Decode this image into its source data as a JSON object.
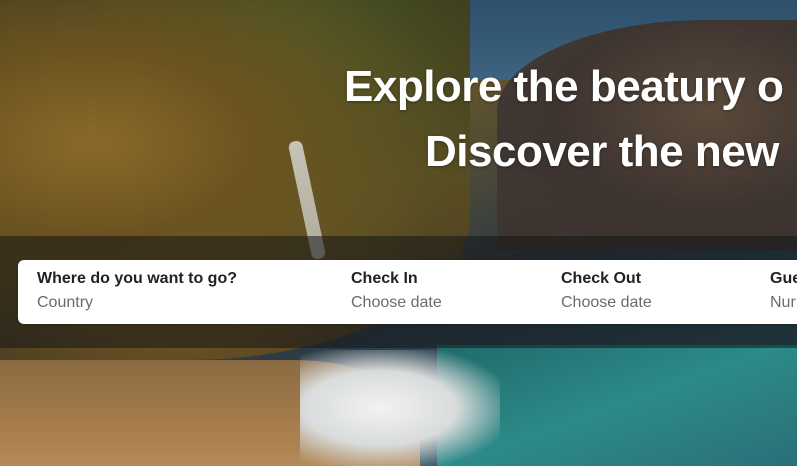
{
  "hero": {
    "headline_line1": "Explore the beatury o",
    "headline_line2": "Discover the new"
  },
  "search": {
    "destination": {
      "label": "Where do you want to go?",
      "value": "Country"
    },
    "check_in": {
      "label": "Check In",
      "value": "Choose date"
    },
    "check_out": {
      "label": "Check Out",
      "value": "Choose date"
    },
    "guests": {
      "label": "Gue",
      "value": "Nur"
    }
  },
  "colors": {
    "card_bg": "#ffffff",
    "label_text": "#222222",
    "value_text": "#6b6b6b",
    "headline_text": "#ffffff"
  }
}
